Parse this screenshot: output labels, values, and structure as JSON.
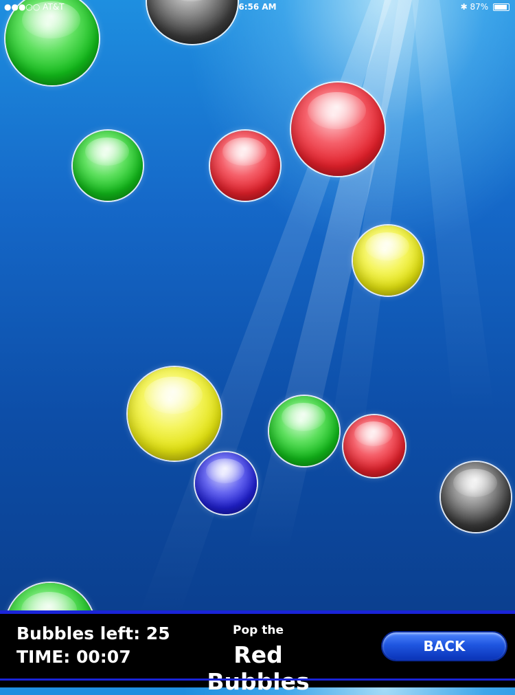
{
  "status_bar": {
    "carrier": "●●●○○ AT&T",
    "time": "6:56 AM",
    "battery": "87%"
  },
  "hud": {
    "bubbles_left": "Bubbles left: 25",
    "time": "TIME: 00:07",
    "pop_the": "Pop the",
    "target": "Red Bubbles",
    "back_label": "BACK"
  },
  "bubbles": [
    {
      "color": "green"
    },
    {
      "color": "black"
    },
    {
      "color": "red"
    },
    {
      "color": "green"
    },
    {
      "color": "red"
    },
    {
      "color": "yellow"
    },
    {
      "color": "yellow"
    },
    {
      "color": "green"
    },
    {
      "color": "red"
    },
    {
      "color": "blue"
    },
    {
      "color": "black"
    },
    {
      "color": "green"
    }
  ]
}
